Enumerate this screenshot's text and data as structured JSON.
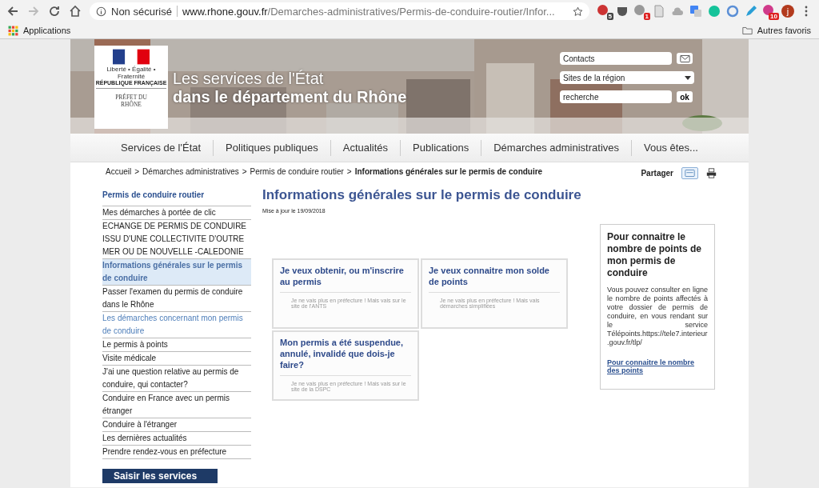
{
  "browser": {
    "security": "Non sécurisé",
    "url_host": "www.rhone.gouv.fr",
    "url_path": "/Demarches-administratives/Permis-de-conduire-routier/Infor...",
    "extension_badges": [
      "5",
      "1",
      "10"
    ],
    "profile": "j",
    "bookmarks": {
      "apps": "Applications",
      "other": "Autres favoris"
    }
  },
  "header": {
    "logo": {
      "motto": "Liberté • Égalité • Fraternité",
      "republic": "RÉPUBLIQUE FRANÇAISE",
      "prefect": "PRÉFET DU RHÔNE"
    },
    "title_line1": "Les services de l'État",
    "title_line2": "dans le département du Rhône",
    "contacts": "Contacts",
    "sites": "Sites de la région",
    "search": "recherche",
    "ok": "ok"
  },
  "nav": [
    "Services de l'État",
    "Politiques publiques",
    "Actualités",
    "Publications",
    "Démarches administratives",
    "Vous êtes..."
  ],
  "breadcrumb": {
    "items": [
      "Accueil",
      "Démarches administratives",
      "Permis de conduire routier"
    ],
    "separator": ">",
    "current": "Informations générales sur le permis de conduire",
    "share": "Partager"
  },
  "sidebar": {
    "title": "Permis de conduire routier",
    "items": [
      {
        "label": "Mes démarches à portée de clic",
        "selected": false,
        "visited": false
      },
      {
        "label": "ECHANGE DE PERMIS DE CONDUIRE ISSU D'UNE COLLECTIVITE D'OUTRE MER OU DE NOUVELLE -CALEDONIE",
        "selected": false,
        "visited": false
      },
      {
        "label": "Informations générales sur le permis de conduire",
        "selected": true,
        "visited": false
      },
      {
        "label": "Passer l'examen du permis de conduire dans le Rhône",
        "selected": false,
        "visited": false
      },
      {
        "label": "Les démarches concernant mon permis de conduire",
        "selected": false,
        "visited": true
      },
      {
        "label": "Le permis à points",
        "selected": false,
        "visited": false
      },
      {
        "label": "Visite médicale",
        "selected": false,
        "visited": false
      },
      {
        "label": "J'ai une question relative au permis de conduire, qui contacter?",
        "selected": false,
        "visited": false
      },
      {
        "label": "Conduire en France avec un permis étranger",
        "selected": false,
        "visited": false
      },
      {
        "label": "Conduire à l'étranger",
        "selected": false,
        "visited": false
      },
      {
        "label": "Les dernières actualités",
        "selected": false,
        "visited": false
      },
      {
        "label": "Prendre rendez-vous en préfecture",
        "selected": false,
        "visited": false
      }
    ],
    "button": "Saisir les services"
  },
  "main": {
    "title": "Informations générales sur le permis de conduire",
    "updated": "Mise à jour le 19/09/2018",
    "cards": [
      {
        "title": "Je veux obtenir, ou m'inscrire  au permis",
        "text": "Je ne vais plus en préfecture ! Mais vais sur le site de l'ANTS"
      },
      {
        "title": "Je veux connaitre mon solde de points",
        "text": "Je ne vais plus en préfecture ! Mais vais démarches simplifiées"
      },
      {
        "title": "Mon permis a été suspendue, annulé, invalidé que dois-je faire?",
        "text": "Je ne vais plus en préfecture ! Mais vais sur le site de la DSPC"
      }
    ]
  },
  "aside": {
    "title": "Pour connaitre le nombre de points de mon permis de conduire",
    "text": "Vous pouvez consulter en ligne le nombre de points affectés à votre dossier de permis de conduire, en vous rendant sur le service Télépoints.https://tele7.interieur.gouv.fr/tlp/",
    "link": "Pour connaitre le nombre des points"
  }
}
